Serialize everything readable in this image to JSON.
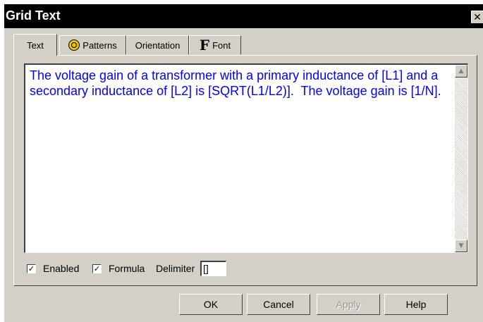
{
  "window": {
    "title": "Grid Text",
    "close_symbol": "✕"
  },
  "tabs": [
    {
      "label": "Text",
      "icon": null,
      "active": true
    },
    {
      "label": "Patterns",
      "icon": "patterns-icon",
      "active": false
    },
    {
      "label": "Orientation",
      "icon": null,
      "active": false
    },
    {
      "label": "Font",
      "icon": "font-F-icon",
      "icon_glyph": "F",
      "active": false
    }
  ],
  "editor": {
    "text": "The voltage gain of a transformer with a primary inductance of [L1] and a secondary inductance of [L2] is [SQRT(L1/L2)].  The voltage gain is [1/N].",
    "text_color": "#0000ff",
    "scroll_up_symbol": "▲",
    "scroll_down_symbol": "▼"
  },
  "options": {
    "enabled": {
      "label": "Enabled",
      "checked": true,
      "mark": "✓"
    },
    "formula": {
      "label": "Formula",
      "checked": true,
      "mark": "✓"
    },
    "delimiter": {
      "label": "Delimiter",
      "value": "[]"
    }
  },
  "buttons": {
    "ok": "OK",
    "cancel": "Cancel",
    "apply": "Apply",
    "help": "Help"
  },
  "colors": {
    "dialog_bg": "#d4d0c8",
    "titlebar_bg": "#000000",
    "title_text": "#ffffff"
  }
}
